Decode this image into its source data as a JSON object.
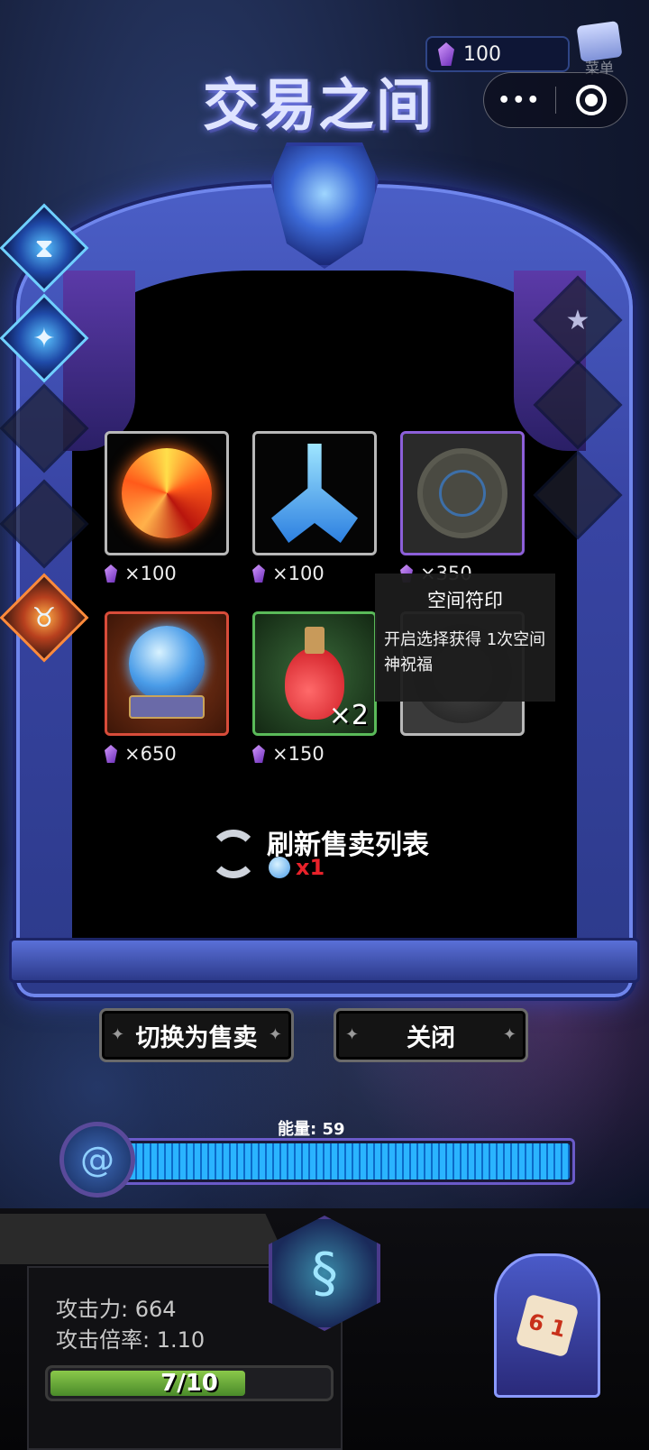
{
  "header": {
    "title": "交易之间",
    "currency_value": "100",
    "menu_label": "菜单",
    "capsule_dots": "•••"
  },
  "shop": {
    "items": [
      {
        "name": "fire-orb",
        "price": "×100"
      },
      {
        "name": "ice-crystal",
        "price": "×100"
      },
      {
        "name": "space-rune",
        "price": "×350"
      },
      {
        "name": "crystal-ball",
        "price": "×650"
      },
      {
        "name": "red-potion",
        "price": "×150",
        "stack": "×2"
      },
      {
        "name": "gray-rune",
        "price": ""
      }
    ],
    "tooltip": {
      "title": "空间符印",
      "description": "开启选择获得 1次空间神祝福"
    },
    "refresh": {
      "label": "刷新售卖列表",
      "cost": "x1"
    }
  },
  "buttons": {
    "switch_label": "切换为售卖",
    "close_label": "关闭"
  },
  "energy": {
    "label": "能量: 59",
    "level": 1.0
  },
  "player": {
    "attack": "攻击力: 664",
    "multiplier": "攻击倍率: 1.10",
    "hp_text": "7/10",
    "hp_fraction": 0.7
  },
  "colors": {
    "accent_blue": "#2ab4ff",
    "frame_blue": "#3844a3",
    "cost_red": "#e8222a",
    "hp_green": "#8ac84a"
  }
}
